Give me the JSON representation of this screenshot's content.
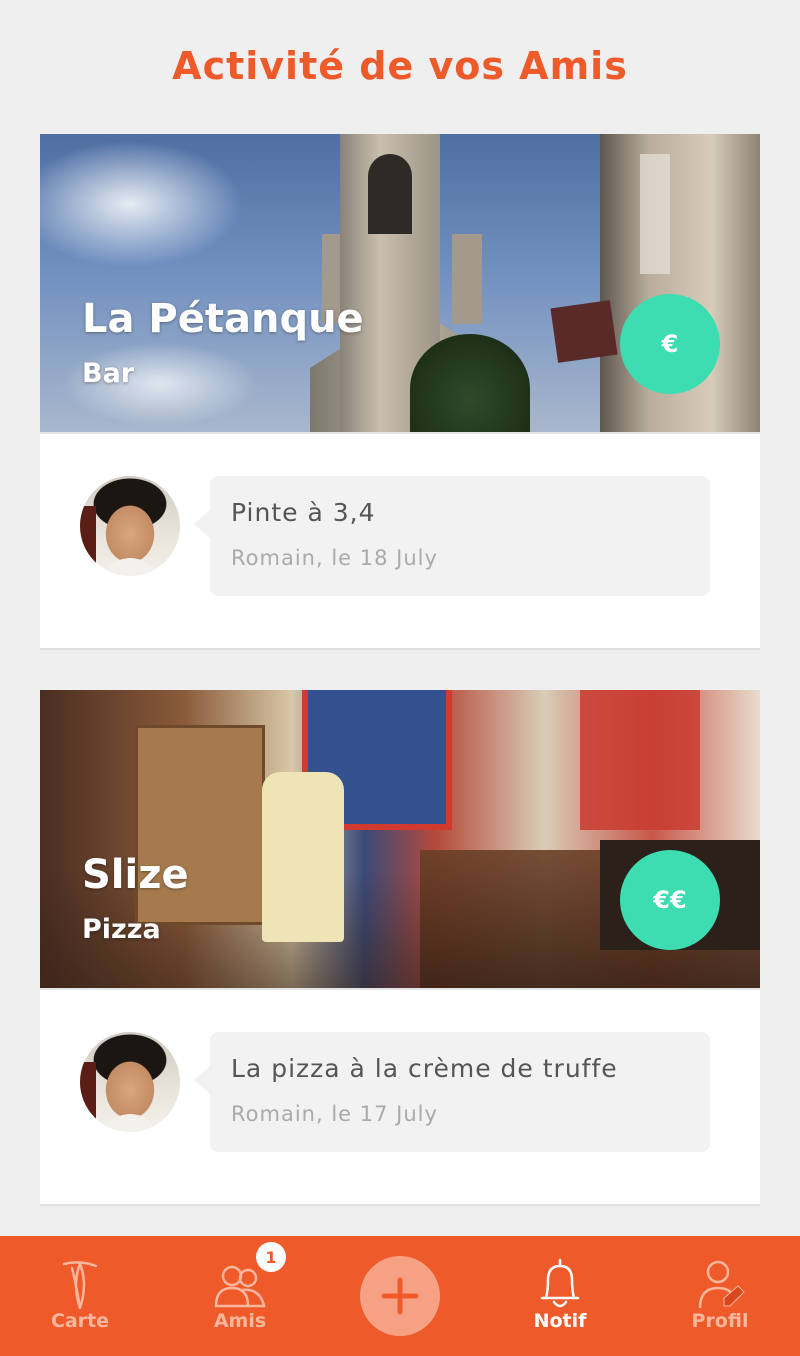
{
  "header": {
    "title": "Activité de vos Amis"
  },
  "feed": [
    {
      "place": "La Pétanque",
      "category": "Bar",
      "price": "€",
      "comment": "Pinte à 3,4",
      "meta": "Romain, le 18 July"
    },
    {
      "place": "Slize",
      "category": "Pizza",
      "price": "€€",
      "comment": "La pizza à la crème de truffe",
      "meta": "Romain, le 17 July"
    }
  ],
  "tabbar": {
    "tabs": [
      {
        "label": "Carte",
        "icon": "map-pin-icon",
        "active": false
      },
      {
        "label": "Amis",
        "icon": "friends-icon",
        "active": false,
        "badge": "1"
      },
      {
        "label": "",
        "icon": "plus-icon",
        "active": false
      },
      {
        "label": "Notif",
        "icon": "bell-icon",
        "active": true
      },
      {
        "label": "Profil",
        "icon": "profile-icon",
        "active": false
      }
    ]
  },
  "colors": {
    "accent": "#ef5a2a",
    "price_badge": "#3ddcb1",
    "background": "#efefef"
  }
}
